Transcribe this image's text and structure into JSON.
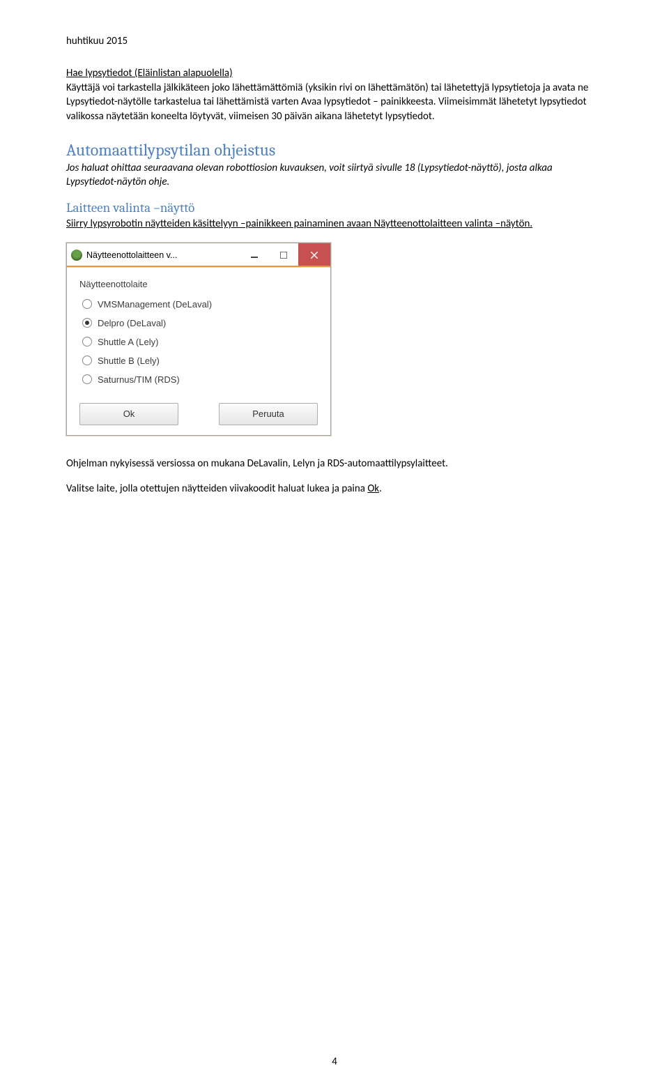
{
  "header": {
    "date": "huhtikuu 2015"
  },
  "section1": {
    "title_combined": "Hae lypsytiedot  (Eläinlistan alapuolella)",
    "para1": "Käyttäjä voi tarkastella jälkikäteen joko lähettämättömiä (yksikin rivi on lähettämätön) tai lähetettyjä lypsytietoja ja avata ne Lypsytiedot-näytölle tarkastelua tai lähettämistä varten Avaa lypsytiedot – painikkeesta. Viimeisimmät lähetetyt lypsytiedot valikossa näytetään koneelta löytyvät, viimeisen 30 päivän aikana lähetetyt lypsytiedot."
  },
  "section2": {
    "heading": "Automaattilypsytilan ohjeistus",
    "para_italic": "Jos haluat ohittaa seuraavana olevan robottiosion kuvauksen, voit siirtyä sivulle 18 (Lypsytiedot-näyttö), josta alkaa Lypsytiedot-näytön ohje."
  },
  "section3": {
    "heading": "Laitteen valinta –näyttö",
    "para": "Siirry lypsyrobotin näytteiden käsittelyyn –painikkeen painaminen avaan Näytteenottolaitteen valinta –näytön."
  },
  "dialog": {
    "title": "Näytteenottolaitteen v...",
    "group_label": "Näytteenottolaite",
    "options": [
      {
        "label": "VMSManagement (DeLaval)",
        "checked": false
      },
      {
        "label": "Delpro (DeLaval)",
        "checked": true
      },
      {
        "label": "Shuttle A (Lely)",
        "checked": false
      },
      {
        "label": "Shuttle B (Lely)",
        "checked": false
      },
      {
        "label": "Saturnus/TIM (RDS)",
        "checked": false
      }
    ],
    "ok": "Ok",
    "cancel": "Peruuta"
  },
  "section4": {
    "para1": "Ohjelman nykyisessä versiossa on mukana DeLavalin, Lelyn ja RDS-automaattilypsylaitteet.",
    "para2_a": "Valitse laite, jolla otettujen näytteiden viivakoodit haluat lukea ja paina ",
    "para2_ok": "Ok",
    "para2_b": "."
  },
  "footer": {
    "page_no": "4"
  }
}
